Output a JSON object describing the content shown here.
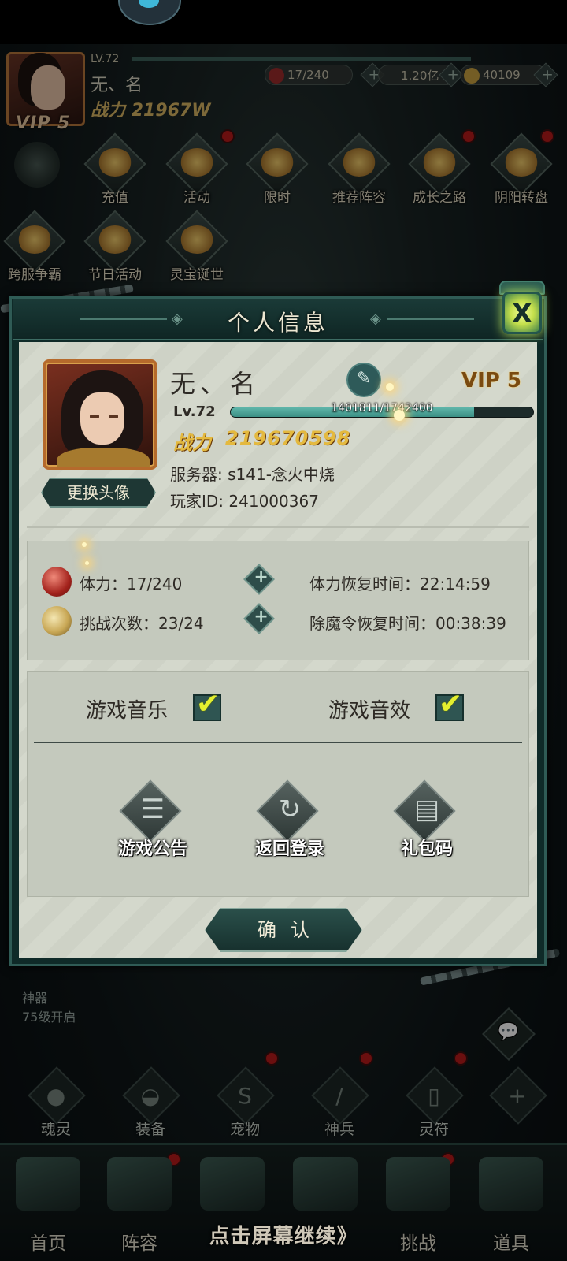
{
  "hud": {
    "level_label": "LV.72",
    "player_name": "无、名",
    "power_label": "战力",
    "power_value": "21967W",
    "vip_label": "VIP 5",
    "resources": [
      {
        "name": "stamina",
        "value": "17/240",
        "color": "#9c2b2b"
      },
      {
        "name": "coins",
        "value": "1.20亿",
        "color": "#b89a4a"
      },
      {
        "name": "ingots",
        "value": "40109",
        "color": "#c8a040"
      }
    ],
    "activities_row1": [
      "充值",
      "活动",
      "限时",
      "推荐阵容",
      "成长之路",
      "阴阳转盘"
    ],
    "activities_row2": [
      "跨服争霸",
      "节日活动",
      "灵宝诞世"
    ],
    "artifact_notice": [
      "神器",
      "75级开启"
    ],
    "feature_icons": [
      "魂灵",
      "装备",
      "宠物",
      "神兵",
      "灵符",
      "+"
    ],
    "bottom_nav": [
      "首页",
      "阵容",
      "",
      "",
      "挑战",
      "道具"
    ],
    "tap_continue": "点击屏幕继续》"
  },
  "dialog": {
    "title": "个人信息",
    "close_label": "X",
    "profile": {
      "name": "无、名",
      "vip": "VIP 5",
      "level": "Lv.72",
      "exp_text": "1401811/1742400",
      "exp_current": 1401811,
      "exp_max": 1742400,
      "power_label": "战力",
      "power_value": "219670598",
      "server": "服务器: s141-念火中烧",
      "player_id": "玩家ID: 241000367",
      "change_avatar_label": "更换头像"
    },
    "stats": {
      "stamina": "体力：17/240",
      "challenges": "挑战次数：23/24",
      "stamina_recovery": "体力恢复时间：22:14:59",
      "token_recovery": "除魔令恢复时间：00:38:39"
    },
    "settings": {
      "music_label": "游戏音乐",
      "music_on": true,
      "sfx_label": "游戏音效",
      "sfx_on": true
    },
    "actions": {
      "announcement": "游戏公告",
      "return_login": "返回登录",
      "gift_code": "礼包码"
    },
    "confirm_label": "确认"
  },
  "colors": {
    "dialog_frame": "#0f2a28",
    "panel_bg": "#d4d8cc",
    "gold": "#e4b93f",
    "accent_teal": "#2e5a59",
    "check_yellow": "#e4ef2f",
    "red_dot": "#b71a1a"
  },
  "icons": {
    "edit": "pencil-icon",
    "close": "close-lantern-icon",
    "plus": "plus-icon",
    "check": "checkmark-icon",
    "announcement": "notice-board-icon",
    "return_login": "refresh-icon",
    "gift_code": "document-icon"
  }
}
